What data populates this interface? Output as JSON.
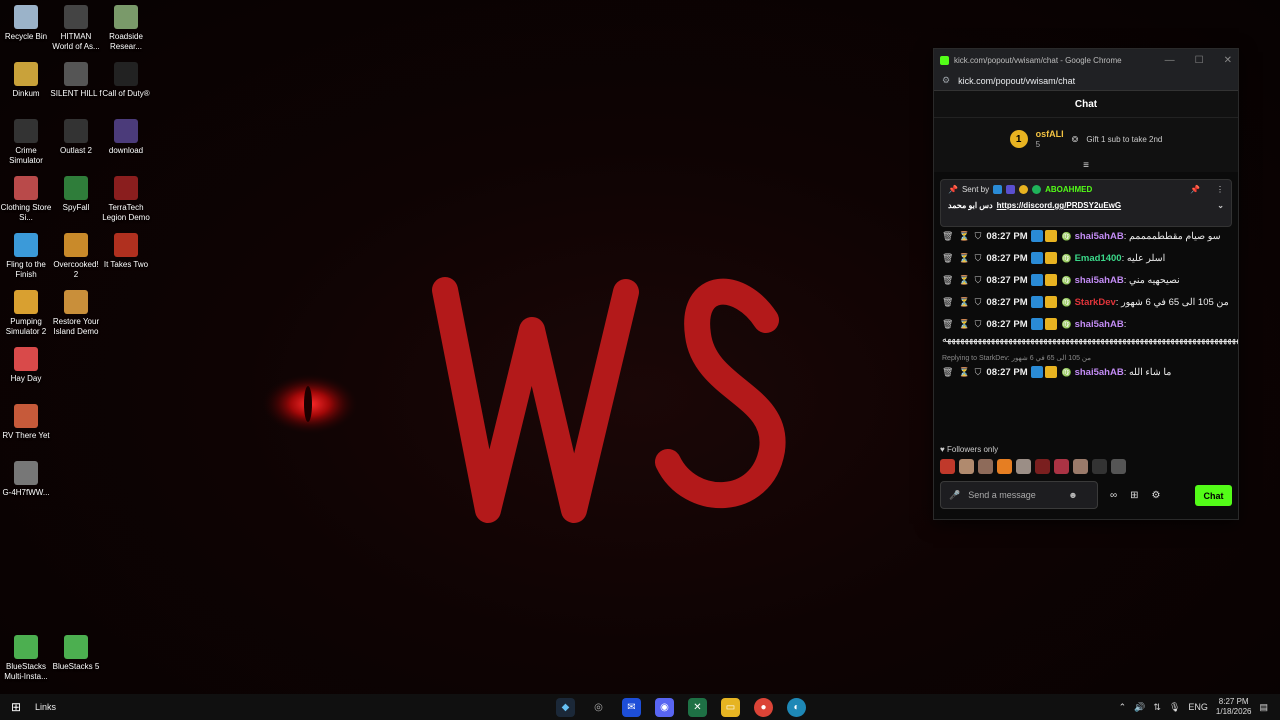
{
  "desktop": {
    "icons": [
      {
        "label": "Recycle Bin"
      },
      {
        "label": "HITMAN World of As..."
      },
      {
        "label": "Roadside Resear..."
      },
      {
        "label": "Dinkum"
      },
      {
        "label": "SILENT HILL f"
      },
      {
        "label": "Call of Duty®"
      },
      {
        "label": "Crime Simulator"
      },
      {
        "label": "Outlast 2"
      },
      {
        "label": "download"
      },
      {
        "label": "Clothing Store Si..."
      },
      {
        "label": "SpyFall"
      },
      {
        "label": "TerraTech Legion Demo"
      },
      {
        "label": "Fling to the Finish"
      },
      {
        "label": "Overcooked! 2"
      },
      {
        "label": "It Takes Two"
      },
      {
        "label": "Pumping Simulator 2"
      },
      {
        "label": "Restore Your Island Demo"
      },
      {
        "label": "Hay Day"
      },
      {
        "label": "RV There Yet"
      },
      {
        "label": "G-4H7fWW..."
      },
      {
        "label": "BlueStacks Multi-Insta..."
      },
      {
        "label": "BlueStacks 5"
      }
    ],
    "wallpaper_text": "WS"
  },
  "chrome": {
    "window_title": "kick.com/popout/vwisam/chat - Google Chrome",
    "address": "kick.com/popout/vwisam/chat"
  },
  "chat": {
    "header": "Chat",
    "gift": {
      "rank": "1",
      "user": "osfALI",
      "count": "5",
      "text": "Gift 1 sub to take 2nd"
    },
    "pinned": {
      "sent_by_label": "Sent by",
      "sender": "ABOAHMED",
      "prefix": "دس ابو محمد",
      "link": "https://discord.gg/PRDSY2uEwG"
    },
    "messages": [
      {
        "time": "08:27 PM",
        "user": "shai5ahAB",
        "user_color": "#c38cf5",
        "text": "سو صيام مقططممممم"
      },
      {
        "time": "08:27 PM",
        "user": "Emad1400",
        "user_color": "#3bd889",
        "text": "اسلر عليه"
      },
      {
        "time": "08:27 PM",
        "user": "shai5ahAB",
        "user_color": "#c38cf5",
        "text": "نصيحهيه مني"
      },
      {
        "time": "08:27 PM",
        "user": "StarkDev",
        "user_color": "#e0343a",
        "text": "من 105 الى 65 في 6 شهور"
      },
      {
        "time": "08:27 PM",
        "user": "shai5ahAB",
        "user_color": "#c38cf5",
        "text": "ههههههههههههههههههههههههههههههههههههههههههههههههههههههههههههههههههههههههههههههههههههههههههههههههههههه"
      },
      {
        "time": "08:27 PM",
        "user": "shai5ahAB",
        "user_color": "#c38cf5",
        "text": "ما شاء الله",
        "reply": "Replying to StarkDev: من 105 الى 65 في 6 شهور"
      }
    ],
    "followers_label": "Followers only",
    "input_placeholder": "Send a message",
    "send_label": "Chat"
  },
  "taskbar": {
    "links_label": "Links",
    "lang": "ENG",
    "time": "8:27 PM",
    "date": "1/18/2026"
  }
}
